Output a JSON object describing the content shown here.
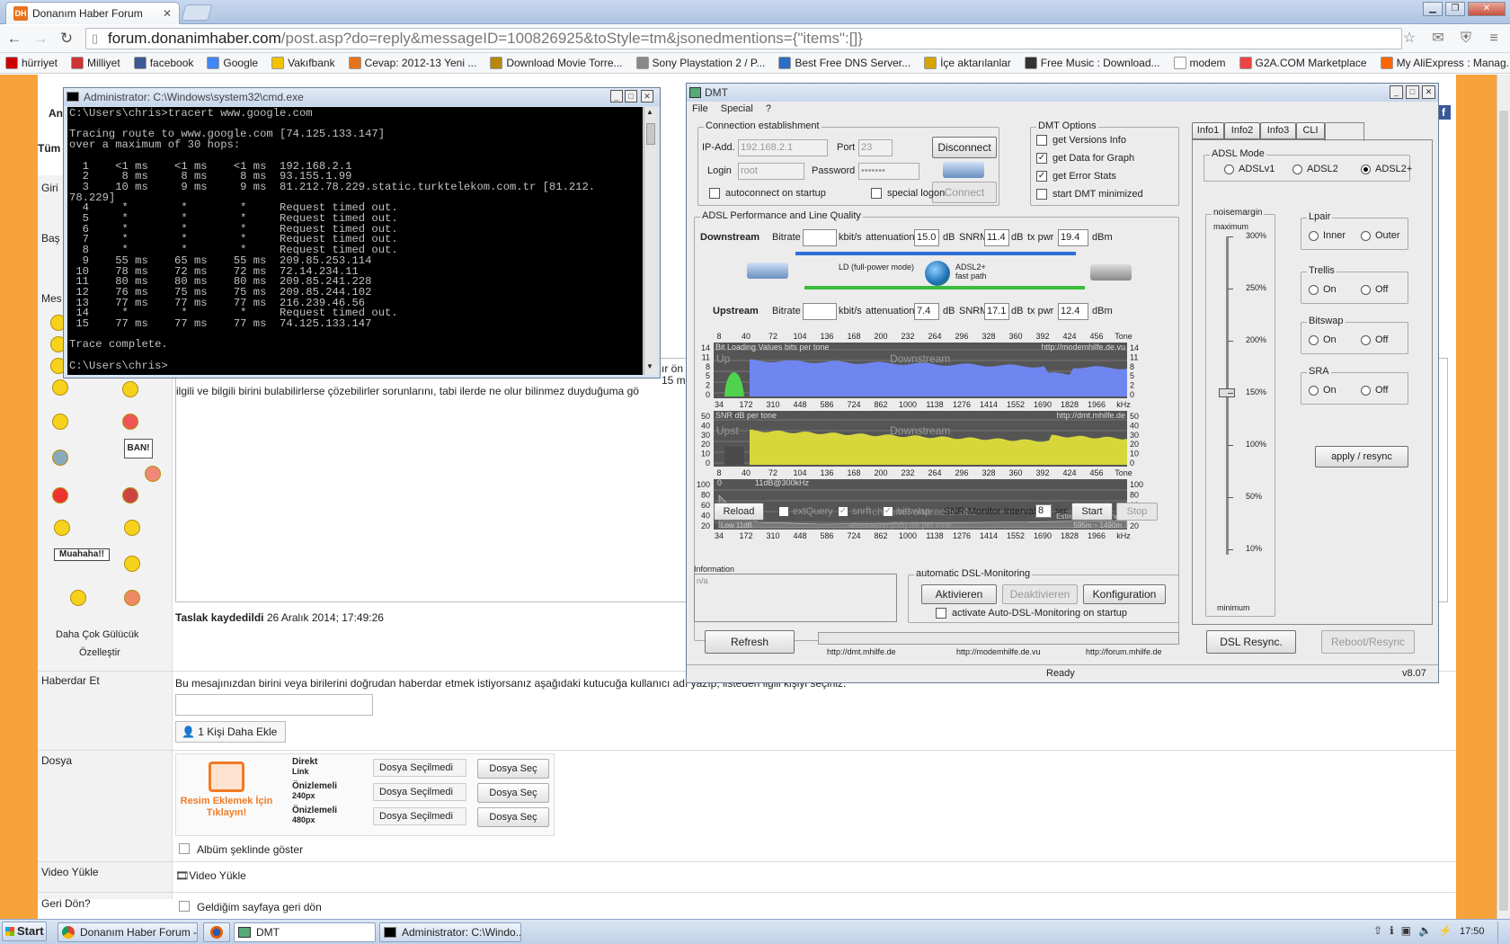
{
  "browser": {
    "tab_title": "Donanım Haber Forum",
    "tab_icon": "DH",
    "url_host": "forum.donanimhaber.com",
    "url_path": "/post.asp?do=reply&messageID=100826925&toStyle=tm&jsonedmentions={\"items\":[]}"
  },
  "bookmarks": [
    "hürriyet",
    "Milliyet",
    "facebook",
    "Google",
    "Vakıfbank",
    "Cevap: 2012-13 Yeni ...",
    "Download Movie Torre...",
    "Sony Playstation 2 / P...",
    "Best Free DNS Server...",
    "İçe aktarılanlar",
    "Free Music : Download...",
    "modem",
    "G2A.COM Marketplace",
    "My AliExpress : Manag..."
  ],
  "forum": {
    "left_labels": [
      "An",
      "Tüm",
      "Giri",
      "Baş",
      "Mes"
    ],
    "msg_line1": "ilgili ve bilgili birini bulabilirlerse çözebilirler sorunlarını,  tabi ilerde ne olur bilinmez duyduğuma gö",
    "msg_frag_right": "ır ön",
    "msg_frag_right2": "15 m",
    "emoticons": [
      "BAN!",
      "Muahaha!!"
    ],
    "more_emoticons": "Daha Çok Gülücük",
    "customize": "Özelleştir",
    "draft_label": "Taslak kaydedildi",
    "draft_time": "26 Aralık 2014; 17:49:26",
    "mention_label": "Haberdar Et",
    "mention_text": "Bu mesajınızdan birini veya birilerini doğrudan haberdar etmek istiyorsanız aşağıdaki kutucuğa kullanıcı adı yazıp, listeden ilgili kişiyi seçiniz.",
    "add_person": "1 Kişi Daha Ekle",
    "file_label": "Dosya",
    "add_image": "Resim Eklemek İçin Tıklayın!",
    "file_rows": [
      {
        "a": "Direkt",
        "b": "Link"
      },
      {
        "a": "Önizlemeli",
        "b": "240px"
      },
      {
        "a": "Önizlemeli",
        "b": "480px"
      }
    ],
    "no_file": "Dosya Seçilmedi",
    "choose_file": "Dosya Seç",
    "album": "Albüm şeklinde göster",
    "video_label": "Video Yükle",
    "video_link": "Video Yükle",
    "goback_label": "Geri Dön?",
    "goback_text": "Geldiğim sayfaya geri dön"
  },
  "cmd": {
    "title": "Administrator: C:\\Windows\\system32\\cmd.exe",
    "text": "C:\\Users\\chris>tracert www.google.com\n\nTracing route to www.google.com [74.125.133.147]\nover a maximum of 30 hops:\n\n  1    <1 ms    <1 ms    <1 ms  192.168.2.1\n  2     8 ms     8 ms     8 ms  93.155.1.99\n  3    10 ms     9 ms     9 ms  81.212.78.229.static.turktelekom.com.tr [81.212.\n78.229]\n  4     *        *        *     Request timed out.\n  5     *        *        *     Request timed out.\n  6     *        *        *     Request timed out.\n  7     *        *        *     Request timed out.\n  8     *        *        *     Request timed out.\n  9    55 ms    65 ms    55 ms  209.85.253.114\n 10    78 ms    72 ms    72 ms  72.14.234.11\n 11    80 ms    80 ms    80 ms  209.85.241.228\n 12    76 ms    75 ms    75 ms  209.85.244.102\n 13    77 ms    77 ms    77 ms  216.239.46.56\n 14     *        *        *     Request timed out.\n 15    77 ms    77 ms    77 ms  74.125.133.147\n\nTrace complete.\n\nC:\\Users\\chris>"
  },
  "dmt": {
    "title": "DMT",
    "menu": [
      "File",
      "Special",
      "?"
    ],
    "conn": {
      "title": "Connection establishment",
      "ip_label": "IP-Add.",
      "ip": "192.168.2.1",
      "port_label": "Port",
      "port": "23",
      "login_label": "Login",
      "login": "root",
      "pw_label": "Password",
      "pw": "•••••••",
      "disconnect": "Disconnect",
      "connect": "Connect",
      "autoconnect": "autoconnect on startup",
      "special_logon": "special logon"
    },
    "opts": {
      "title": "DMT Options",
      "items": [
        "get Versions Info",
        "get Data for Graph",
        "get Error Stats",
        "start DMT minimized"
      ]
    },
    "tabs": [
      "Info1",
      "Info2",
      "Info3",
      "CLI"
    ],
    "perf": {
      "title": "ADSL Performance and Line Quality",
      "downstream": "Downstream",
      "upstream": "Upstream",
      "bitrate": "Bitrate",
      "kbits": "kbit/s",
      "atten": "attenuation",
      "db": "dB",
      "snrm": "SNRM",
      "txpwr": "tx pwr",
      "dbm": "dBm",
      "ds_att": "15.0",
      "ds_snrm": "11.4",
      "ds_tx": "19.4",
      "us_att": "7.4",
      "us_snrm": "17.1",
      "us_tx": "12.4",
      "mode_text": "LD (full-power mode)",
      "adsl_text": "ADSL2+",
      "fast_path": "fast path"
    },
    "ticks_tone": [
      "8",
      "40",
      "72",
      "104",
      "136",
      "168",
      "200",
      "232",
      "264",
      "296",
      "328",
      "360",
      "392",
      "424",
      "456",
      "Tone"
    ],
    "ticks_khz": [
      "34",
      "172",
      "310",
      "448",
      "586",
      "724",
      "862",
      "1000",
      "1138",
      "1276",
      "1414",
      "1552",
      "1690",
      "1828",
      "1966",
      "kHz"
    ],
    "g1": {
      "title": "Bit Loading Values   bits per tone",
      "src": "http://modemhilfe.de.vu",
      "up": "Up",
      "down": "Downstream",
      "y": [
        "14",
        "11",
        "8",
        "5",
        "2",
        "0"
      ]
    },
    "g2": {
      "title": "SNR  dB per tone",
      "src": "http://dmt.mhilfe.de",
      "up": "Upst",
      "down": "Downstream",
      "y": [
        "50",
        "40",
        "30",
        "20",
        "10",
        "0"
      ]
    },
    "g3": {
      "title": "11dB@300kHz",
      "label": "channel characteristic",
      "sub": "attenuation (DS)  dB per tone",
      "low": "Low 11dB",
      "est": "Estimated loop length",
      "est2": "595m ~ 1490m",
      "y": [
        "100",
        "80",
        "60",
        "40",
        "20"
      ],
      "zero": "0"
    },
    "bottom": {
      "reload": "Reload",
      "extquery": "extQuery",
      "snrft": "snrft",
      "bitswap": "bitswap",
      "snr_mon": "SNR-Monitor Interval:",
      "snr_val": "8",
      "sec": "sec",
      "start": "Start",
      "stop": "Stop"
    },
    "info": {
      "title": "Information",
      "text": "n/a"
    },
    "auto": {
      "title": "automatic DSL-Monitoring",
      "aktivieren": "Aktivieren",
      "deaktivieren": "Deaktivieren",
      "konfig": "Konfiguration",
      "startup": "activate Auto-DSL-Monitoring on startup"
    },
    "links": [
      "http://dmt.mhilfe.de",
      "http://modemhilfe.de.vu",
      "http://forum.mhilfe.de"
    ],
    "refresh": "Refresh",
    "dsl_resync": "DSL Resync.",
    "reboot": "Reboot/Resync",
    "status": "Ready",
    "version": "v8.07",
    "adsl": {
      "title": "ADSL Mode",
      "modes": [
        "ADSLv1",
        "ADSL2",
        "ADSL2+"
      ],
      "selected": "ADSL2+",
      "nm_title": "noisemargin",
      "maximum": "maximum",
      "minimum": "minimum",
      "scale": [
        "300%",
        "250%",
        "200%",
        "150%",
        "100%",
        "50%",
        "10%"
      ],
      "level_pct": 150,
      "lpair": {
        "title": "Lpair",
        "a": "Inner",
        "b": "Outer"
      },
      "groups": [
        {
          "title": "Trellis"
        },
        {
          "title": "Bitswap"
        },
        {
          "title": "SRA"
        }
      ],
      "on": "On",
      "off": "Off",
      "apply": "apply / resync"
    }
  },
  "taskbar": {
    "start": "Start",
    "items": [
      "Donanım Haber Forum - ...",
      "",
      "DMT",
      "Administrator: C:\\Windo..."
    ],
    "time": "17:50"
  }
}
